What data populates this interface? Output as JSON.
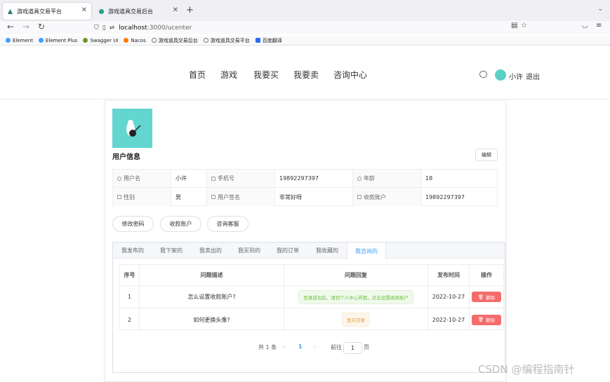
{
  "browser": {
    "tabs": [
      {
        "title": "游戏道具交易平台",
        "active": true
      },
      {
        "title": "游戏道具交易后台",
        "active": false
      }
    ],
    "url_host": "localhost",
    "url_path": ":3000/ucenter",
    "bookmarks": [
      {
        "label": "Element",
        "color": "#409eff"
      },
      {
        "label": "Element Plus",
        "color": "#409eff"
      },
      {
        "label": "Swagger UI",
        "color": "#6a9a23"
      },
      {
        "label": "Nacos",
        "color": "#ff7b00"
      },
      {
        "label": "游戏道具交易后台",
        "color": "#777777"
      },
      {
        "label": "游戏道具交易平台",
        "color": "#777777"
      },
      {
        "label": "百度翻译",
        "color": "#2a6ff5"
      }
    ]
  },
  "site": {
    "nav": [
      "首页",
      "游戏",
      "我要买",
      "我要卖",
      "咨询中心"
    ],
    "username": "小许",
    "logout": "退出"
  },
  "profile": {
    "section_title": "用户信息",
    "edit_label": "编辑",
    "row1": {
      "username_label": "用户名",
      "username_value": "小许",
      "phone_label": "手机号",
      "phone_value": "19892297397",
      "age_label": "年龄",
      "age_value": "18"
    },
    "row2": {
      "gender_label": "性别",
      "gender_value": "男",
      "signature_label": "用户签名",
      "signature_value": "非常好呀",
      "account_label": "收款账户",
      "account_value": "19892297397"
    },
    "actions": [
      "修改密码",
      "收款账户",
      "咨询客服"
    ]
  },
  "tabs": [
    "我发布的",
    "我下架的",
    "我卖出的",
    "我买到的",
    "我的订单",
    "我收藏的",
    "我咨询的"
  ],
  "active_tab_index": 6,
  "table": {
    "headers": [
      "序号",
      "问题描述",
      "问题回复",
      "发布时间",
      "操作"
    ],
    "rows": [
      {
        "index": "1",
        "question": "怎么设置收款账户?",
        "reply": "登录成功后，请到个人中心界面，点击设置收款账户",
        "reply_status": "success",
        "date": "2022-10-27",
        "action": "删除"
      },
      {
        "index": "2",
        "question": "如何更换头像?",
        "reply": "暂未回复",
        "reply_status": "warning",
        "date": "2022-10-27",
        "action": "删除"
      }
    ]
  },
  "pagination": {
    "total": "共 1 条",
    "current": "1",
    "goto_prefix": "前往",
    "goto_value": "1",
    "goto_suffix": "页"
  },
  "watermark": "CSDN @编程指南针",
  "colors": {
    "primary": "#409eff",
    "danger": "#f56c6c",
    "success": "#67c23a",
    "warning": "#e6a23c",
    "avatar": "#63d6d0"
  }
}
